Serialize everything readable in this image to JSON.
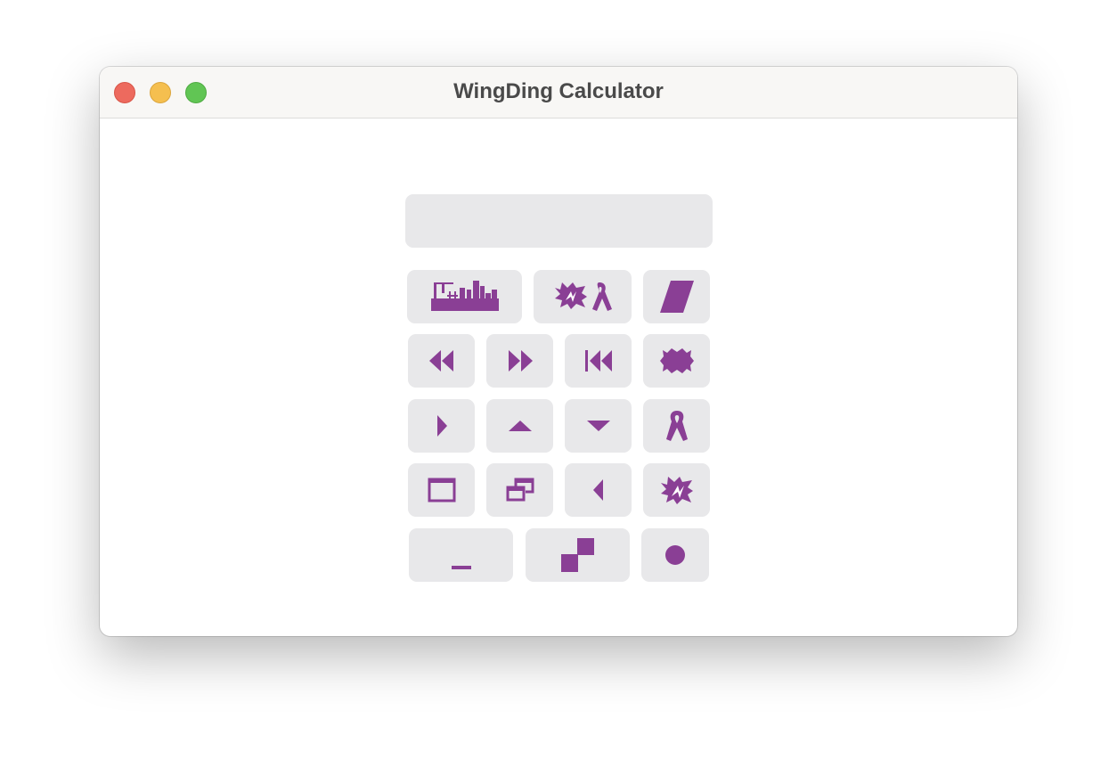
{
  "window": {
    "title": "WingDing Calculator"
  },
  "display": {
    "value": ""
  },
  "colors": {
    "glyph": "#8a3f95",
    "key_background": "#e8e8ea",
    "title_bar": "#f8f7f5",
    "traffic_close": "#ed6a5e",
    "traffic_minimize": "#f5bf4f",
    "traffic_maximize": "#61c554"
  },
  "keypad": {
    "rows": [
      [
        "cityscape-glyph",
        "explosion-ribbon-glyph",
        "parallelogram-glyph"
      ],
      [
        "rewind-glyph",
        "fast-forward-glyph",
        "skip-back-glyph",
        "burst-glyph"
      ],
      [
        "play-right-glyph",
        "triangle-up-glyph",
        "triangle-down-glyph",
        "ribbon-glyph"
      ],
      [
        "window-glyph",
        "double-window-glyph",
        "play-left-glyph",
        "explosion-glyph"
      ],
      [
        "underscore-glyph",
        "checker-squares-glyph",
        "circle-glyph"
      ]
    ]
  }
}
